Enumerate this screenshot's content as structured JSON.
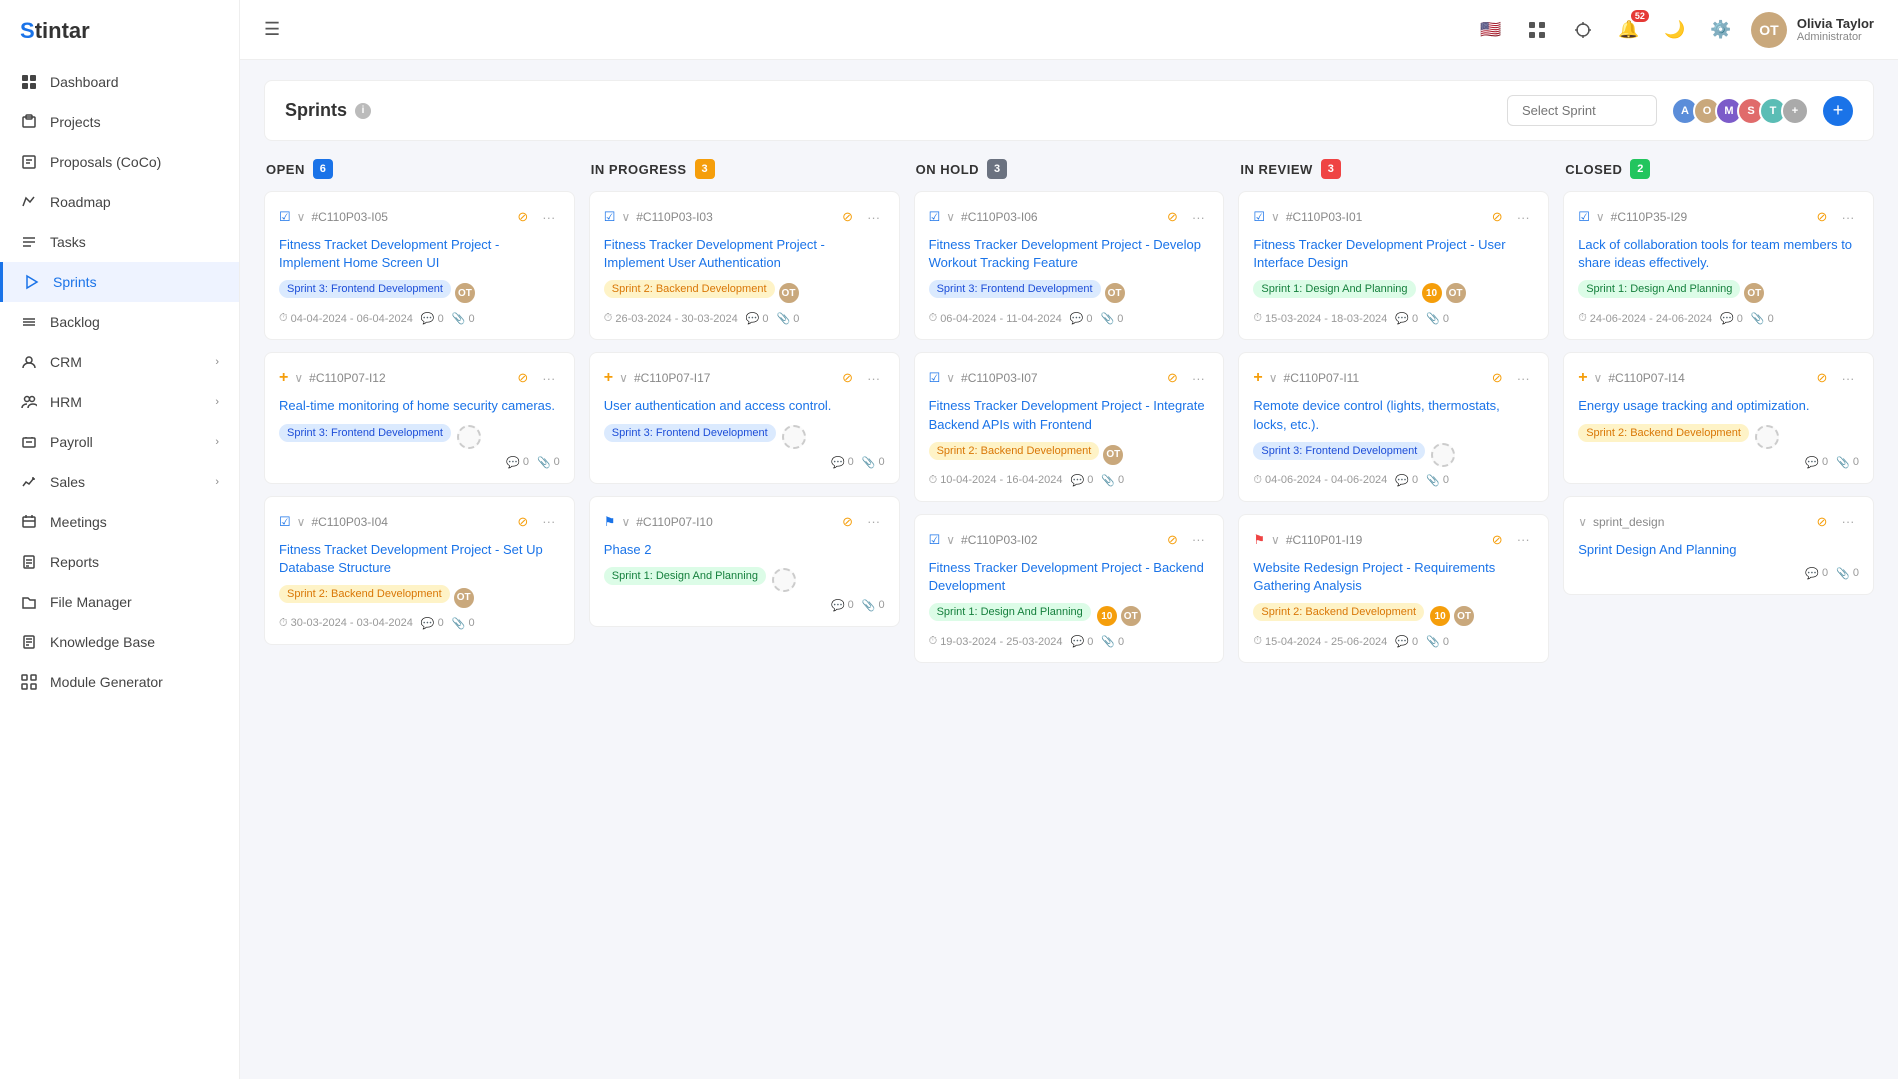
{
  "app": {
    "name": "Stintar"
  },
  "sidebar": {
    "items": [
      {
        "id": "dashboard",
        "label": "Dashboard",
        "icon": "○"
      },
      {
        "id": "projects",
        "label": "Projects",
        "icon": "◫"
      },
      {
        "id": "proposals",
        "label": "Proposals (CoCo)",
        "icon": "◻"
      },
      {
        "id": "roadmap",
        "label": "Roadmap",
        "icon": "◫"
      },
      {
        "id": "tasks",
        "label": "Tasks",
        "icon": "☰"
      },
      {
        "id": "sprints",
        "label": "Sprints",
        "icon": "◈",
        "active": true
      },
      {
        "id": "backlog",
        "label": "Backlog",
        "icon": "◫"
      },
      {
        "id": "crm",
        "label": "CRM",
        "icon": "◫",
        "arrow": true
      },
      {
        "id": "hrm",
        "label": "HRM",
        "icon": "◫",
        "arrow": true
      },
      {
        "id": "payroll",
        "label": "Payroll",
        "icon": "◫",
        "arrow": true
      },
      {
        "id": "sales",
        "label": "Sales",
        "icon": "◫",
        "arrow": true
      },
      {
        "id": "meetings",
        "label": "Meetings",
        "icon": "◫"
      },
      {
        "id": "reports",
        "label": "Reports",
        "icon": "◫"
      },
      {
        "id": "file-manager",
        "label": "File Manager",
        "icon": "◫"
      },
      {
        "id": "knowledge-base",
        "label": "Knowledge Base",
        "icon": "◫"
      },
      {
        "id": "module-generator",
        "label": "Module Generator",
        "icon": "◫"
      }
    ]
  },
  "header": {
    "notification_count": "52",
    "user": {
      "name": "Olivia Taylor",
      "role": "Administrator"
    }
  },
  "sprints": {
    "title": "Sprints",
    "select_placeholder": "Select Sprint",
    "add_label": "+",
    "columns": [
      {
        "id": "open",
        "title": "OPEN",
        "count": "6",
        "badge_color": "badge-blue",
        "cards": [
          {
            "id": "#C110P03-I05",
            "type": "check",
            "title": "Fitness Tracket Development Project - Implement Home Screen UI",
            "tag": "Sprint 3: Frontend Development",
            "tag_color": "tag-blue",
            "date": "04-04-2024 - 06-04-2024",
            "comments": "0",
            "attachments": "0",
            "avatar_color": "#c9a87c"
          },
          {
            "id": "#C110P07-I12",
            "type": "plus",
            "title": "Real-time monitoring of home security cameras.",
            "tag": "Sprint 3: Frontend Development",
            "tag_color": "tag-blue",
            "date": "",
            "comments": "0",
            "attachments": "0",
            "avatar_color": null
          },
          {
            "id": "#C110P03-I04",
            "type": "check",
            "title": "Fitness Tracket Development Project - Set Up Database Structure",
            "tag": "Sprint 2: Backend Development",
            "tag_color": "tag-orange",
            "date": "30-03-2024 - 03-04-2024",
            "comments": "0",
            "attachments": "0",
            "avatar_color": "#c9a87c"
          }
        ]
      },
      {
        "id": "in_progress",
        "title": "IN PROGRESS",
        "count": "3",
        "badge_color": "badge-orange",
        "cards": [
          {
            "id": "#C110P03-I03",
            "type": "check",
            "title": "Fitness Tracker Development Project - Implement User Authentication",
            "tag": "Sprint 2: Backend Development",
            "tag_color": "tag-orange",
            "date": "26-03-2024 - 30-03-2024",
            "comments": "0",
            "attachments": "0",
            "avatar_color": "#c9a87c"
          },
          {
            "id": "#C110P07-I17",
            "type": "plus",
            "title": "User authentication and access control.",
            "tag": "Sprint 3: Frontend Development",
            "tag_color": "tag-blue",
            "date": "",
            "comments": "0",
            "attachments": "0",
            "avatar_color": null
          },
          {
            "id": "#C110P07-I10",
            "type": "flag",
            "title": "Phase 2",
            "tag": "Sprint 1: Design And Planning",
            "tag_color": "tag-green",
            "date": "",
            "comments": "0",
            "attachments": "0",
            "avatar_color": null
          }
        ]
      },
      {
        "id": "on_hold",
        "title": "ON HOLD",
        "count": "3",
        "badge_color": "badge-gray",
        "cards": [
          {
            "id": "#C110P03-I06",
            "type": "check",
            "title": "Fitness Tracker Development Project - Develop Workout Tracking Feature",
            "tag": "Sprint 3: Frontend Development",
            "tag_color": "tag-blue",
            "date": "06-04-2024 - 11-04-2024",
            "comments": "0",
            "attachments": "0",
            "avatar_color": "#c9a87c"
          },
          {
            "id": "#C110P03-I07",
            "type": "check",
            "title": "Fitness Tracker Development Project - Integrate Backend APIs with Frontend",
            "tag": "Sprint 2: Backend Development",
            "tag_color": "tag-orange",
            "date": "10-04-2024 - 16-04-2024",
            "comments": "0",
            "attachments": "0",
            "avatar_color": "#c9a87c"
          },
          {
            "id": "#C110P03-I02",
            "type": "check",
            "title": "Fitness Tracker Development Project - Backend Development",
            "tag": "Sprint 1: Design And Planning",
            "tag_color": "tag-green",
            "date": "19-03-2024 - 25-03-2024",
            "comments": "0",
            "attachments": "0",
            "num_badge": "10",
            "avatar_color": "#c9a87c"
          }
        ]
      },
      {
        "id": "in_review",
        "title": "IN REVIEW",
        "count": "3",
        "badge_color": "badge-red",
        "cards": [
          {
            "id": "#C110P03-I01",
            "type": "check",
            "title": "Fitness Tracker Development Project - User Interface Design",
            "tag": "Sprint 1: Design And Planning",
            "tag_color": "tag-green",
            "date": "15-03-2024 - 18-03-2024",
            "comments": "0",
            "attachments": "0",
            "num_badge": "10",
            "avatar_color": "#c9a87c"
          },
          {
            "id": "#C110P07-I11",
            "type": "plus",
            "title": "Remote device control (lights, thermostats, locks, etc.).",
            "tag": "Sprint 3: Frontend Development",
            "tag_color": "tag-blue",
            "date": "04-06-2024 - 04-06-2024",
            "comments": "0",
            "attachments": "0",
            "avatar_color": null
          },
          {
            "id": "#C110P01-I19",
            "type": "flag_blue",
            "title": "Website Redesign Project - Requirements Gathering Analysis",
            "tag": "Sprint 2: Backend Development",
            "tag_color": "tag-orange",
            "date": "15-04-2024 - 25-06-2024",
            "comments": "0",
            "attachments": "0",
            "num_badge": "10",
            "avatar_color": "#c9a87c"
          }
        ]
      },
      {
        "id": "closed",
        "title": "CLOSED",
        "count": "2",
        "badge_color": "badge-green",
        "cards": [
          {
            "id": "#C110P35-I29",
            "type": "check",
            "title": "Lack of collaboration tools for team members to share ideas effectively.",
            "tag": "Sprint 1: Design And Planning",
            "tag_color": "tag-green",
            "date": "24-06-2024 - 24-06-2024",
            "comments": "0",
            "attachments": "0",
            "avatar_color": "#c9a87c"
          },
          {
            "id": "#C110P07-I14",
            "type": "plus",
            "title": "Energy usage tracking and optimization.",
            "tag": "Sprint 2: Backend Development",
            "tag_color": "tag-orange",
            "date": "",
            "comments": "0",
            "attachments": "0",
            "avatar_color": null
          },
          {
            "id": "sprint_design",
            "type": "none",
            "is_sprint_card": true,
            "title": "Sprint Design And Planning",
            "tag": "",
            "date": "",
            "comments": "0",
            "attachments": "0"
          }
        ]
      }
    ],
    "avatars": [
      {
        "color": "#5b8dd9",
        "initials": "A"
      },
      {
        "color": "#c9a87c",
        "initials": "O"
      },
      {
        "color": "#7c5bc9",
        "initials": "M"
      },
      {
        "color": "#e06b6b",
        "initials": "S"
      },
      {
        "color": "#5bbdb5",
        "initials": "T"
      },
      {
        "color": "#aaa",
        "initials": "+"
      }
    ]
  }
}
